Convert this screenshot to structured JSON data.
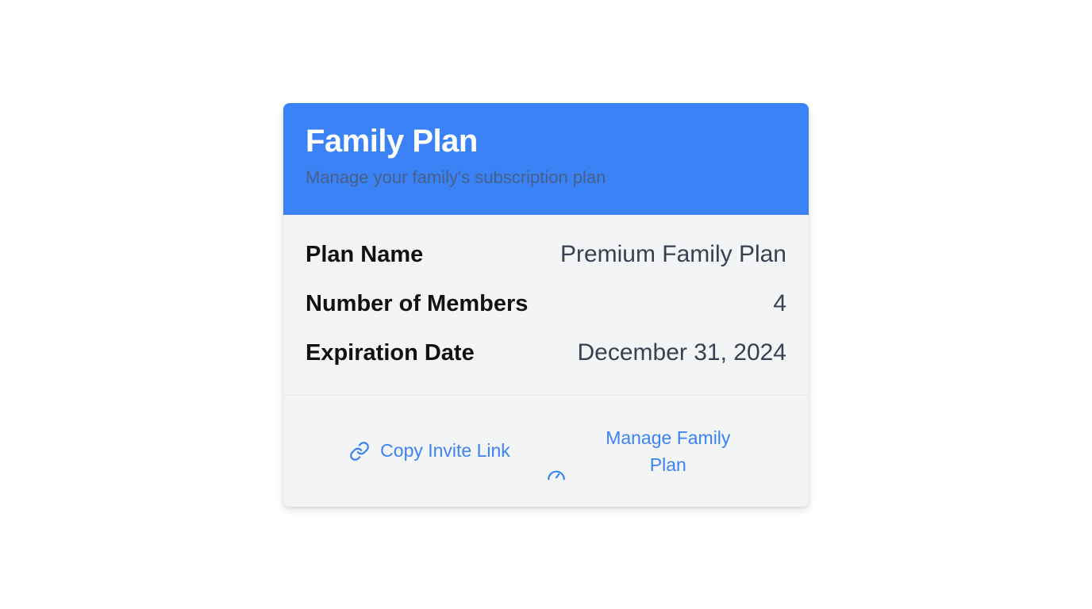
{
  "header": {
    "title": "Family Plan",
    "subtitle": "Manage your family's subscription plan"
  },
  "details": [
    {
      "label": "Plan Name",
      "value": "Premium Family Plan"
    },
    {
      "label": "Number of Members",
      "value": "4"
    },
    {
      "label": "Expiration Date",
      "value": "December 31, 2024"
    }
  ],
  "actions": {
    "copy_invite_label": "Copy Invite Link",
    "copy_invite_icon": "link-icon",
    "manage_plan_label": "Manage Family Plan",
    "manage_plan_icon": "gauge-icon"
  },
  "colors": {
    "header_bg": "#3b82f6",
    "card_bg": "#f3f4f6",
    "accent": "#3b82f6"
  }
}
